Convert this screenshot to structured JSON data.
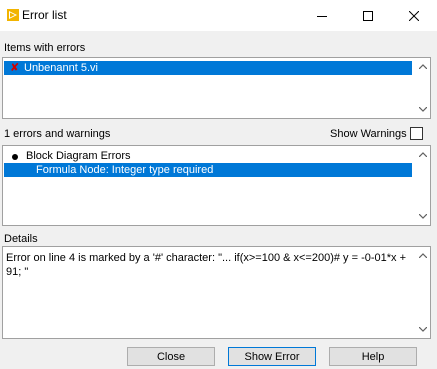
{
  "window": {
    "title": "Error list"
  },
  "items_section": {
    "label": "Items with errors",
    "items": [
      {
        "label": "Unbenannt 5.vi",
        "selected": true,
        "icon": "error-x-icon"
      }
    ]
  },
  "errors_section": {
    "count_label": "1 errors and warnings",
    "show_warnings_label": "Show Warnings",
    "show_warnings_checked": false,
    "groups": [
      {
        "label": "Block Diagram Errors",
        "icon": "bullet-icon"
      }
    ],
    "entries": [
      {
        "label": "Formula Node: Integer type required",
        "selected": true
      }
    ]
  },
  "details_section": {
    "label": "Details",
    "text": "Error on line 4 is marked by a '#' character: \"... if(x>=100 & x<=200)# y = -0-01*x + 91; \""
  },
  "buttons": {
    "close": "Close",
    "show_error": "Show Error",
    "help": "Help"
  },
  "colors": {
    "selection": "#0078d7",
    "error_mark": "#d00000",
    "window_bg": "#f0f0f0"
  }
}
